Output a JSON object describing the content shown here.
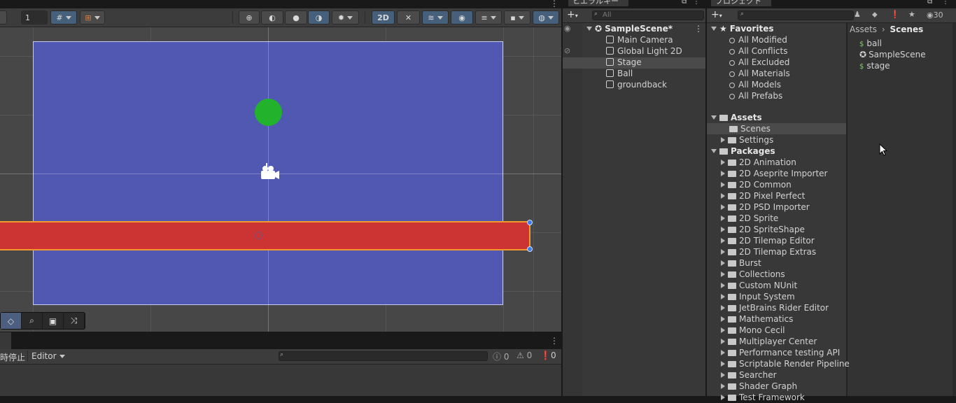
{
  "scene": {
    "toolbar": {
      "gizmo_scale": "1",
      "btn_2d": "2D"
    },
    "overlay_tools": [
      "◇",
      "⌕",
      "▣",
      "⤨"
    ],
    "colors": {
      "camera_bg": "#5058b2",
      "ball": "#22b22c",
      "stage": "#cc3333",
      "stage_outline": "#f29a2e"
    }
  },
  "console": {
    "pause_label": "時停止",
    "editor_label": "Editor",
    "info_count": "0",
    "warning_count": "0",
    "error_count": "0"
  },
  "hierarchy": {
    "tab_label": "ヒエラルキー",
    "search_placeholder": "All",
    "scene_name": "SampleScene*",
    "items": [
      "Main Camera",
      "Global Light 2D",
      "Stage",
      "Ball",
      "groundback"
    ],
    "selected": "Stage"
  },
  "project": {
    "tab_label": "プロジェクト",
    "hidden_count": "30",
    "favorites_label": "Favorites",
    "favorites": [
      "All Modified",
      "All Conflicts",
      "All Excluded",
      "All Materials",
      "All Models",
      "All Prefabs"
    ],
    "assets_label": "Assets",
    "assets": [
      "Scenes",
      "Settings"
    ],
    "packages_label": "Packages",
    "packages": [
      "2D Animation",
      "2D Aseprite Importer",
      "2D Common",
      "2D Pixel Perfect",
      "2D PSD Importer",
      "2D Sprite",
      "2D SpriteShape",
      "2D Tilemap Editor",
      "2D Tilemap Extras",
      "Burst",
      "Collections",
      "Custom NUnit",
      "Input System",
      "JetBrains Rider Editor",
      "Mathematics",
      "Mono Cecil",
      "Multiplayer Center",
      "Performance testing API",
      "Scriptable Render Pipeline",
      "Searcher",
      "Shader Graph",
      "Test Framework"
    ],
    "breadcrumb": [
      "Assets",
      "Scenes"
    ],
    "files": [
      "ball",
      "SampleScene",
      "stage"
    ]
  }
}
